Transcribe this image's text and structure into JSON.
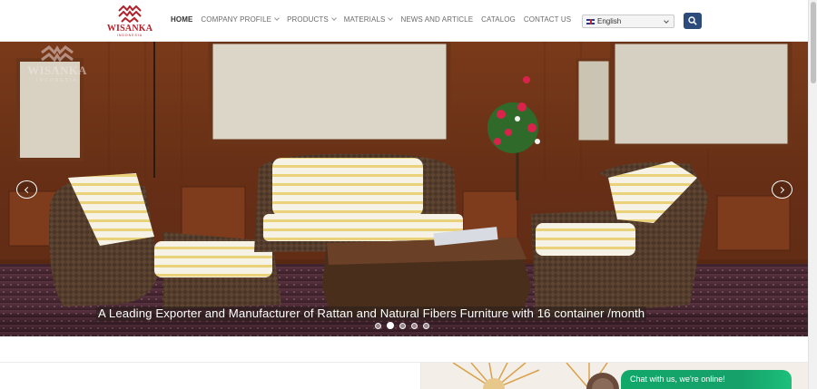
{
  "logo": {
    "name": "WISANKA",
    "sub": "INDONESIA"
  },
  "nav": {
    "items": [
      {
        "label": "HOME",
        "dropdown": false
      },
      {
        "label": "COMPANY PROFILE",
        "dropdown": true
      },
      {
        "label": "PRODUCTS",
        "dropdown": true
      },
      {
        "label": "MATERIALS",
        "dropdown": true
      },
      {
        "label": "NEWS AND ARTICLE",
        "dropdown": false
      },
      {
        "label": "CATALOG",
        "dropdown": false
      },
      {
        "label": "CONTACT US",
        "dropdown": false
      }
    ],
    "active_index": 0
  },
  "language": {
    "selected": "English",
    "flag_icon": "uk-flag-icon"
  },
  "search": {
    "icon": "search-icon"
  },
  "hero": {
    "watermark": "WISANKA",
    "watermark_sub": "INDONESIA",
    "caption": "A Leading Exporter and Manufacturer of Rattan and Natural Fibers Furniture with 16 container /month",
    "slide_count": 5,
    "active_slide": 2
  },
  "chat": {
    "label": "Chat with us, we're online!"
  },
  "colors": {
    "brand_red": "#b3202a",
    "search_blue": "#2c4a7a",
    "chat_green": "#12a86a"
  }
}
